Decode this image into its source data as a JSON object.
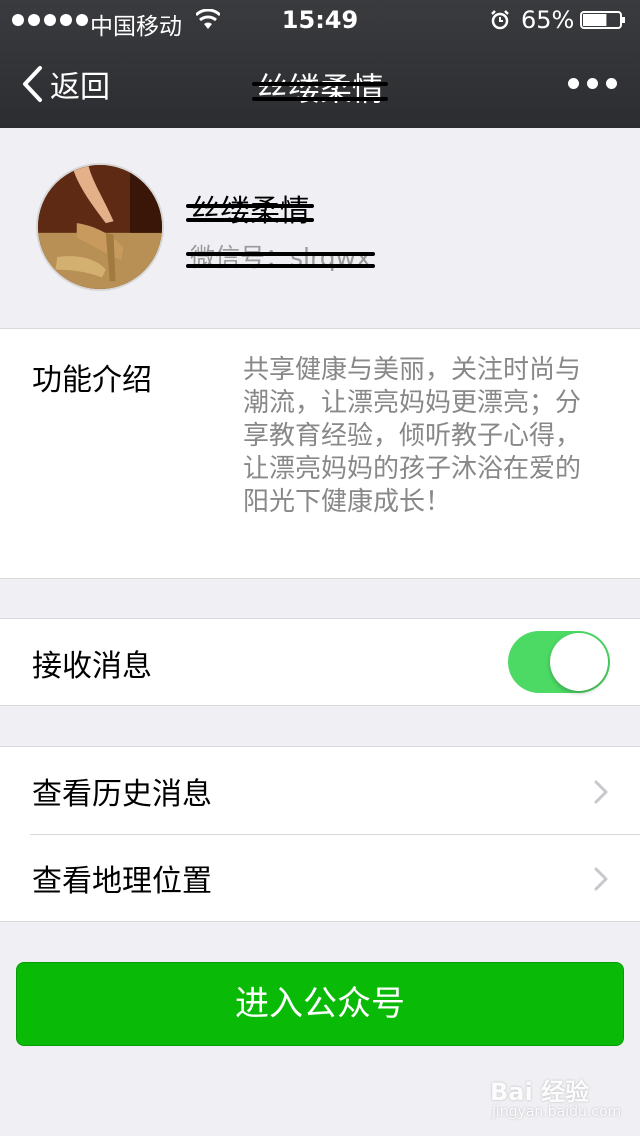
{
  "status_bar": {
    "carrier": "中国移动",
    "time": "15:49",
    "battery_percent": "65%",
    "battery_level": 0.65
  },
  "nav": {
    "back_label": "返回",
    "title": "丝缕柔情"
  },
  "profile": {
    "name": "丝缕柔情",
    "wechat_id": "微信号：slrqwx"
  },
  "intro": {
    "label": "功能介绍",
    "text": "共享健康与美丽，关注时尚与潮流，让漂亮妈妈更漂亮；分享教育经验，倾听教子心得，让漂亮妈妈的孩子沐浴在爱的阳光下健康成长！"
  },
  "receive_messages": {
    "label": "接收消息",
    "enabled": true
  },
  "links": [
    {
      "label": "查看历史消息"
    },
    {
      "label": "查看地理位置"
    }
  ],
  "enter_button": {
    "label": "进入公众号"
  },
  "watermark": {
    "text": "Bai 经验",
    "sub": "jingyan.baidu.com"
  },
  "colors": {
    "nav_bg": "#2c2d30",
    "toggle_on": "#4cd964",
    "primary_green": "#09bb07",
    "page_bg": "#efeff4"
  }
}
